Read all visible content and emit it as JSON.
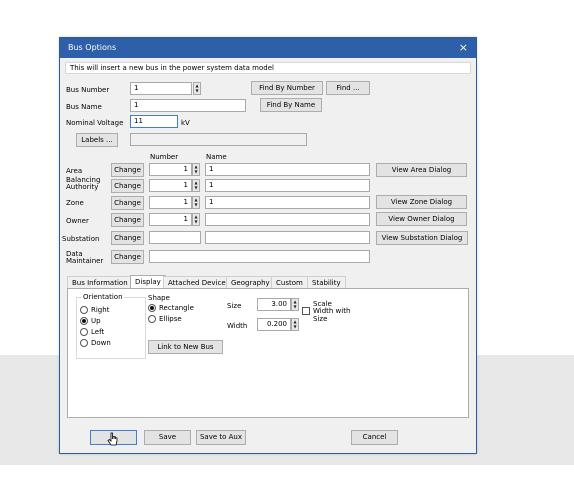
{
  "dialog": {
    "title": "Bus Options",
    "close_glyph": "×",
    "info": "This will insert a new bus in the power system data model"
  },
  "bus": {
    "number_label": "Bus Number",
    "number_value": "1",
    "find_by_number": "Find By Number",
    "find": "Find ...",
    "name_label": "Bus Name",
    "name_value": "1",
    "find_by_name": "Find By Name",
    "voltage_label": "Nominal Voltage",
    "voltage_value": "11",
    "voltage_unit": "kV",
    "labels_button": "Labels ...",
    "labels_value": ""
  },
  "grid": {
    "number_header": "Number",
    "name_header": "Name",
    "change": "Change",
    "rows": [
      {
        "label": "Area",
        "number": "1",
        "name": "1",
        "button": "View Area Dialog"
      },
      {
        "label1": "Balancing",
        "label2": "Authority",
        "number": "1",
        "name": "1",
        "button": ""
      },
      {
        "label": "Zone",
        "number": "1",
        "name": "1",
        "button": "View Zone Dialog"
      },
      {
        "label": "Owner",
        "number": "1",
        "name": "",
        "button": "View Owner Dialog"
      },
      {
        "label": "Substation",
        "number": "",
        "name": "",
        "button": "View Substation Dialog"
      },
      {
        "label1": "Data",
        "label2": "Maintainer",
        "number": "",
        "name": "",
        "button": ""
      }
    ]
  },
  "tabs": [
    "Bus Information",
    "Display",
    "Attached Devices",
    "Geography",
    "Custom",
    "Stability"
  ],
  "active_tab": "Display",
  "display": {
    "orientation_title": "Orientation",
    "orientation_options": [
      "Right",
      "Up",
      "Left",
      "Down"
    ],
    "orientation_selected": "Up",
    "shape_title": "Shape",
    "shape_options": [
      "Rectangle",
      "Ellipse"
    ],
    "shape_selected": "Rectangle",
    "size_label": "Size",
    "size_value": "3.00",
    "width_label": "Width",
    "width_value": "0.200",
    "scale_label": "Scale",
    "scale_width_label": "Width with",
    "scale_size_label": "Size",
    "scale_checked": false,
    "link_button": "Link to New Bus"
  },
  "footer": {
    "ok_label": "",
    "save": "Save",
    "save_to_aux": "Save to Aux",
    "cancel": "Cancel"
  },
  "colors": {
    "title_bar": "#2e5fa9",
    "focus_border": "#3c7fd4"
  }
}
